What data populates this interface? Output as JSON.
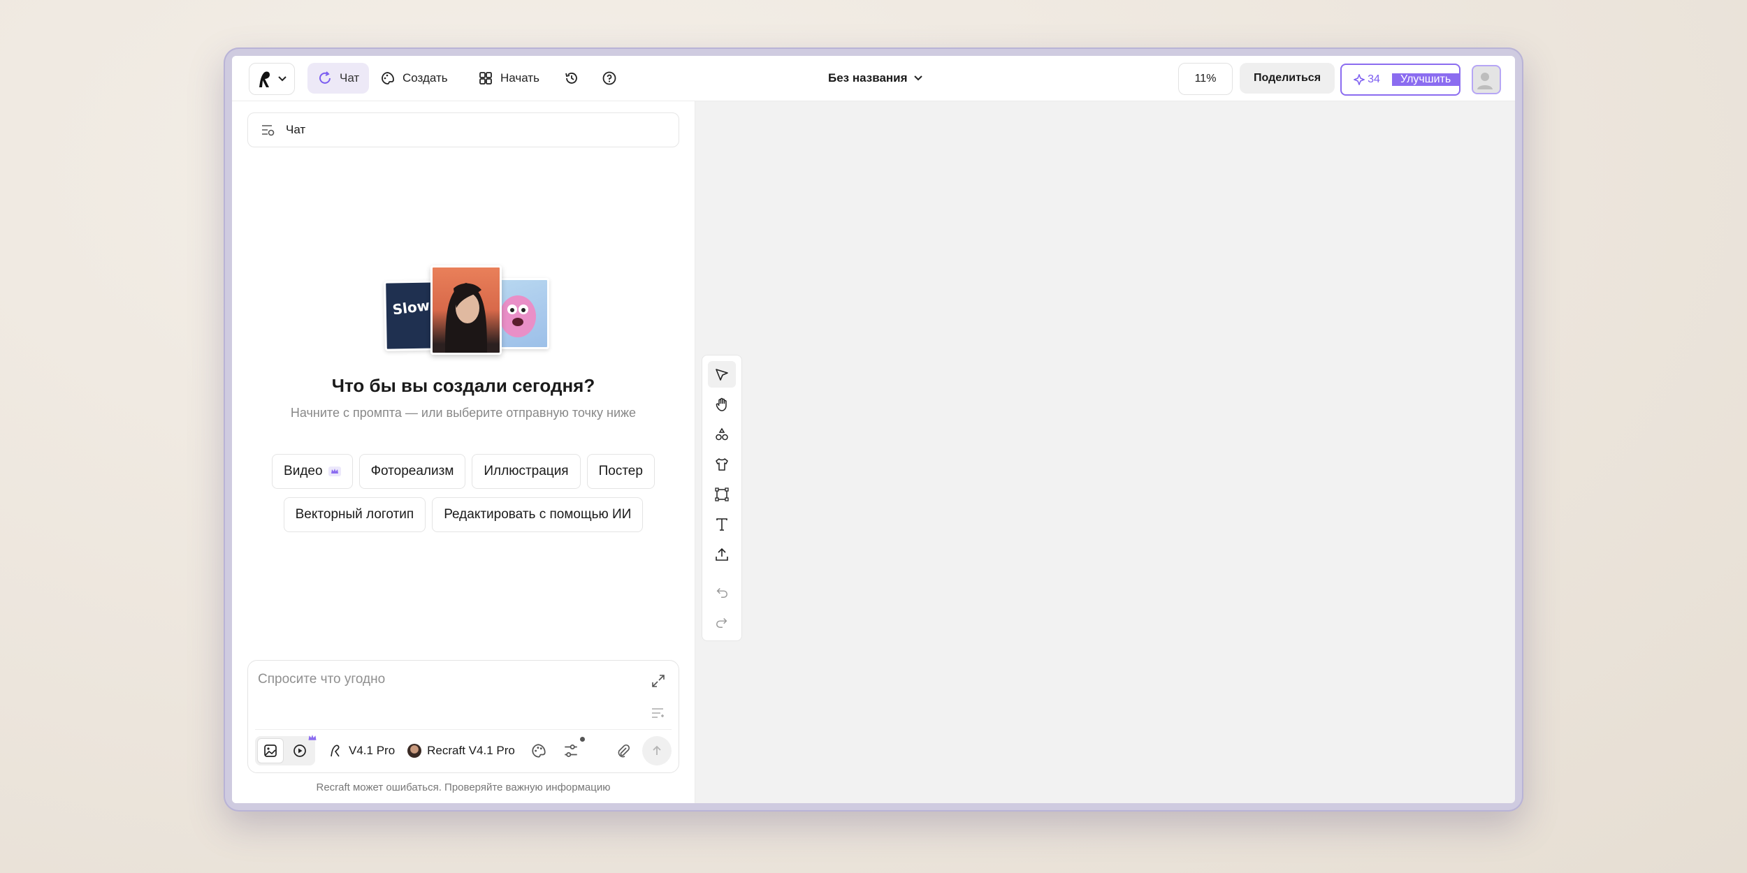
{
  "topbar": {
    "tabs": [
      {
        "label": "Чат"
      },
      {
        "label": "Создать"
      },
      {
        "label": "Начать"
      }
    ],
    "document_title": "Без названия",
    "zoom": "11%",
    "share_label": "Поделиться",
    "credits": "34",
    "upgrade_label": "Улучшить"
  },
  "chat": {
    "header_label": "Чат",
    "hero_title": "Что бы вы создали сегодня?",
    "hero_subtitle": "Начните с промпта — или выберите отправную точку ниже",
    "hero_card_text": "Slow Bloom",
    "chips_row1": [
      {
        "label": "Видео"
      },
      {
        "label": "Фотореализм"
      },
      {
        "label": "Иллюстрация"
      },
      {
        "label": "Постер"
      }
    ],
    "chips_row2": [
      {
        "label": "Векторный логотип"
      },
      {
        "label": "Редактировать с помощью ИИ"
      }
    ],
    "prompt_placeholder": "Спросите что угодно",
    "style_label": "V4.1 Pro",
    "model_label": "Recraft V4.1 Pro",
    "disclaimer": "Recraft может ошибаться. Проверяйте важную информацию"
  },
  "colors": {
    "accent": "#8b6cf0",
    "active_tab_bg": "#ede9f7",
    "canvas_bg": "#f2f2f2"
  }
}
